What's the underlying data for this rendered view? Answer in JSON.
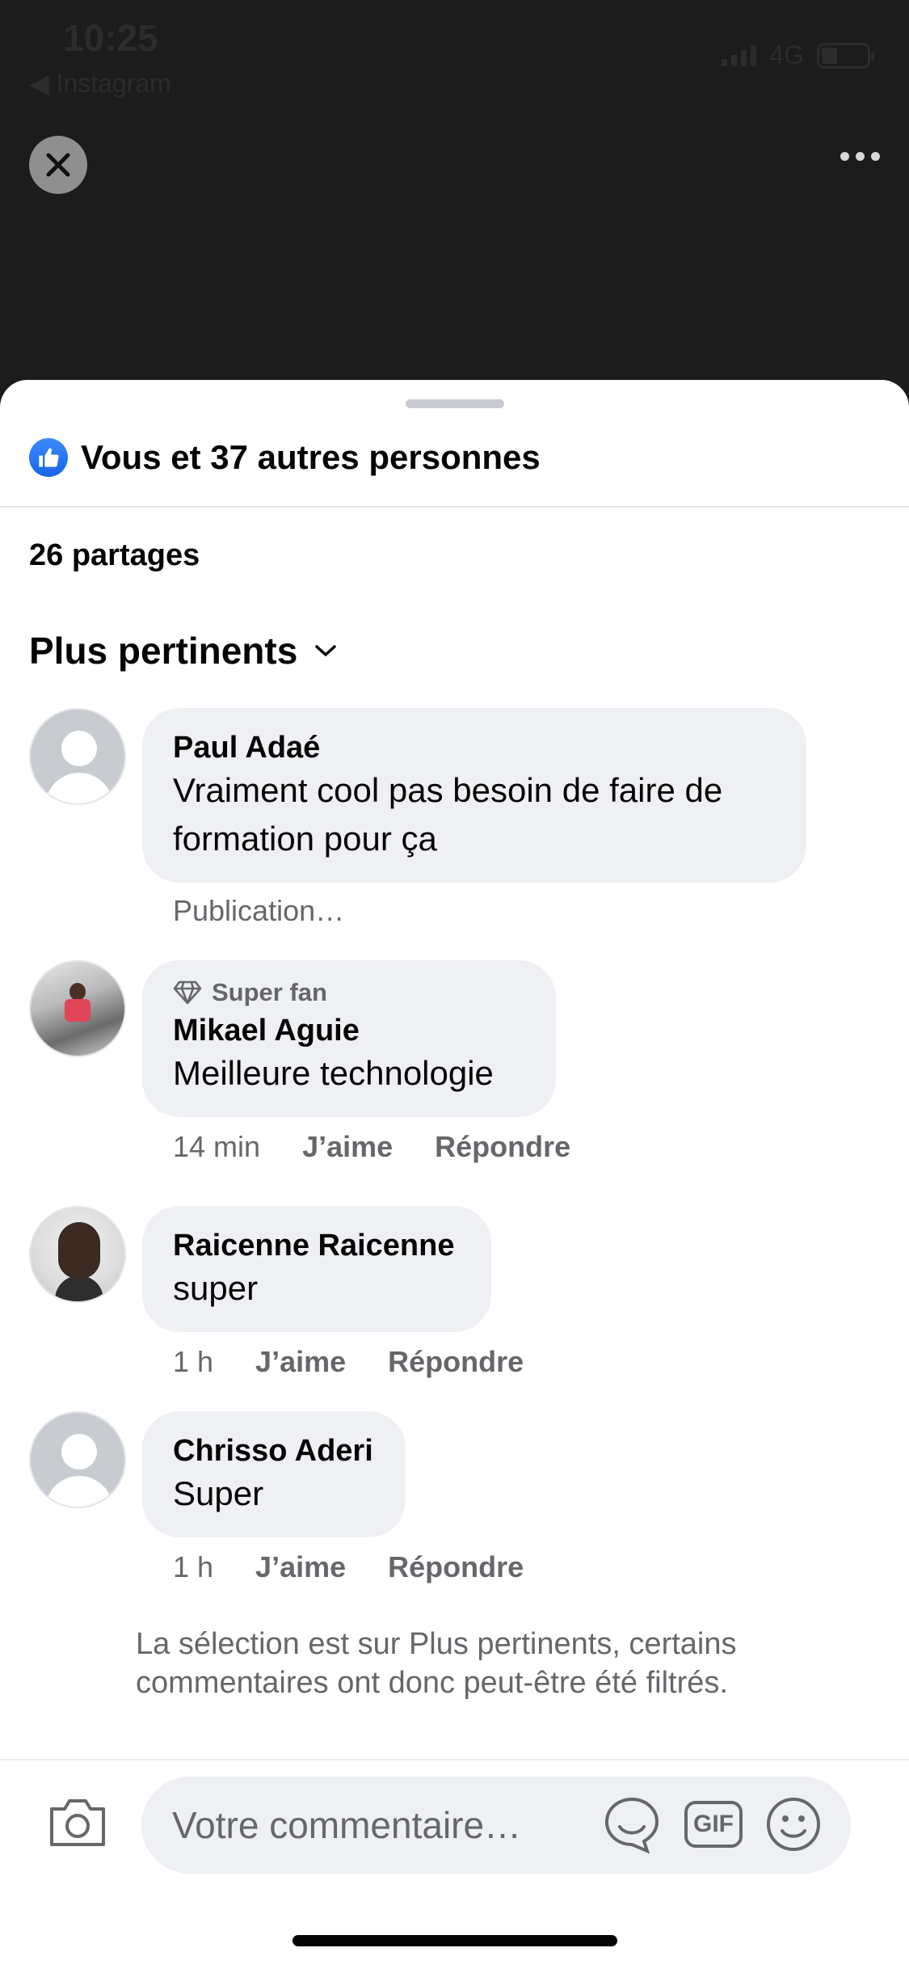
{
  "status_bar": {
    "time": "10:25",
    "back_app": "◀ Instagram",
    "network": "4G",
    "battery_level": 0.35
  },
  "header": {
    "close_icon": "close-icon",
    "more_icon": "more-options-icon"
  },
  "reactions": {
    "summary": "Vous et 37 autres personnes",
    "icon": "like-thumb-icon",
    "accent": "#1877f2"
  },
  "shares": "26 partages",
  "sort": {
    "label": "Plus pertinents",
    "icon": "chevron-down-icon"
  },
  "comments": [
    {
      "name": "Paul Adaé",
      "badge": "",
      "text_line1": "Vraiment cool pas besoin de faire de",
      "text_line2": "formation pour ça",
      "status": "Publication…"
    },
    {
      "name": "Mikael Aguie",
      "badge": "Super fan",
      "text": "Meilleure technologie",
      "time": "14 min",
      "like": "J’aime",
      "reply": "Répondre"
    },
    {
      "name": "Raicenne Raicenne",
      "text": "super",
      "time": "1 h",
      "like": "J’aime",
      "reply": "Répondre"
    },
    {
      "name": "Chrisso Aderi",
      "text": "Super",
      "time": "1 h",
      "like": "J’aime",
      "reply": "Répondre"
    }
  ],
  "filter_note_line1": "La sélection est sur Plus pertinents, certains",
  "filter_note_line2": "commentaires ont donc peut-être été filtrés.",
  "composer": {
    "placeholder": "Votre commentaire…",
    "camera_icon": "camera-icon",
    "sticker_icon": "sticker-icon",
    "gif_label": "GIF",
    "emoji_icon": "emoji-icon"
  }
}
